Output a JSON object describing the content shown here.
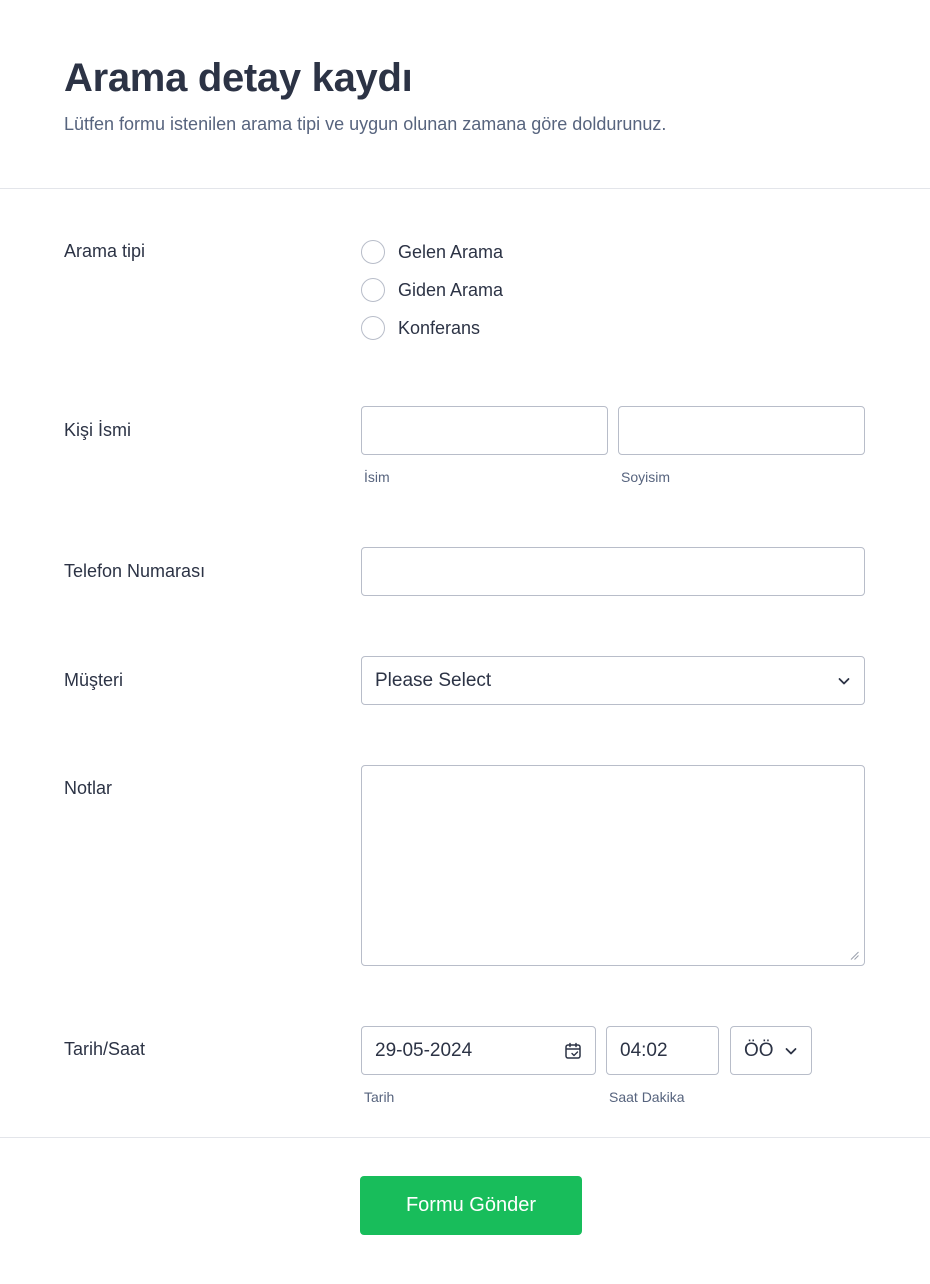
{
  "header": {
    "title": "Arama detay kaydı",
    "subtitle": "Lütfen formu istenilen arama tipi ve uygun olunan zamana göre doldurunuz."
  },
  "call_type": {
    "label": "Arama tipi",
    "options": [
      "Gelen Arama",
      "Giden Arama",
      "Konferans"
    ]
  },
  "person_name": {
    "label": "Kişi İsmi",
    "first_value": "",
    "last_value": "",
    "first_sublabel": "İsim",
    "last_sublabel": "Soyisim"
  },
  "phone": {
    "label": "Telefon Numarası",
    "value": ""
  },
  "customer": {
    "label": "Müşteri",
    "selected": "Please Select"
  },
  "notes": {
    "label": "Notlar",
    "value": ""
  },
  "datetime": {
    "label": "Tarih/Saat",
    "date_value": "29-05-2024",
    "time_value": "04:02",
    "ampm_value": "ÖÖ",
    "date_sublabel": "Tarih",
    "time_sublabel": "Saat Dakika"
  },
  "footer": {
    "submit_label": "Formu Gönder"
  },
  "colors": {
    "submit_bg": "#18bd5b",
    "text_primary": "#2c3345",
    "text_secondary": "#57647e",
    "border": "#b8bdc9"
  }
}
